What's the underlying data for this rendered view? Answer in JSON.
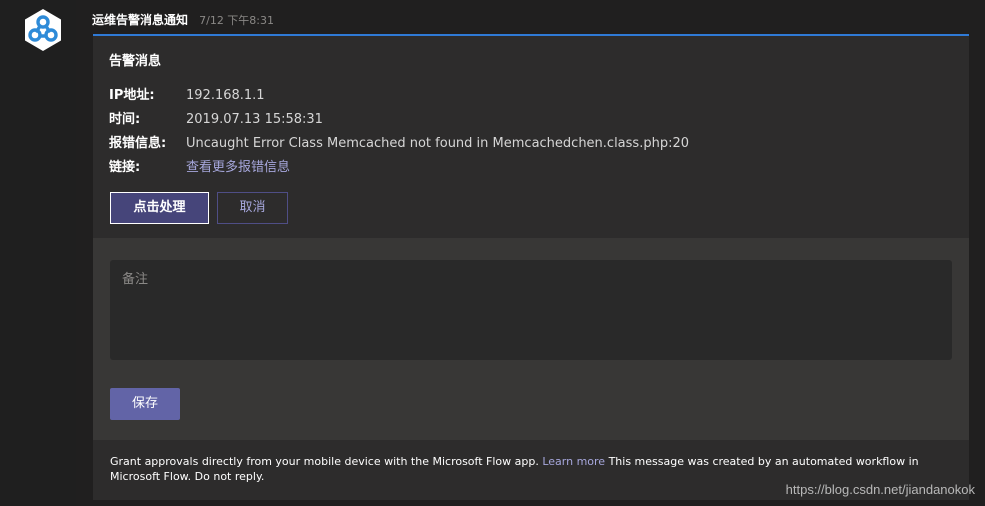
{
  "message": {
    "sender": "运维告警消息通知",
    "timestamp": "7/12 下午8:31"
  },
  "card": {
    "title": "告警消息",
    "facts": [
      {
        "label": "IP地址:",
        "value": "192.168.1.1"
      },
      {
        "label": "时间:",
        "value": "2019.07.13 15:58:31"
      },
      {
        "label": "报错信息:",
        "value": "Uncaught Error Class Memcached not found in Memcachedchen.class.php:20"
      },
      {
        "label": "链接:",
        "value": "查看更多报错信息"
      }
    ],
    "actions": {
      "primary": "点击处理",
      "secondary": "取消"
    },
    "form": {
      "note_placeholder": "备注",
      "save_label": "保存"
    },
    "footer": {
      "text_before": "Grant approvals directly from your mobile device with the Microsoft Flow app.",
      "link": "Learn more",
      "text_after": "This message was created by an automated workflow in Microsoft Flow. Do not reply."
    }
  },
  "watermark": "https://blog.csdn.net/jiandanokok",
  "colors": {
    "accent_border": "#2f7ad6",
    "primary_button": "#46457a",
    "save_button": "#6264a7",
    "link": "#a6a7dc"
  },
  "icons": {
    "avatar": "bot-avatar-icon"
  }
}
